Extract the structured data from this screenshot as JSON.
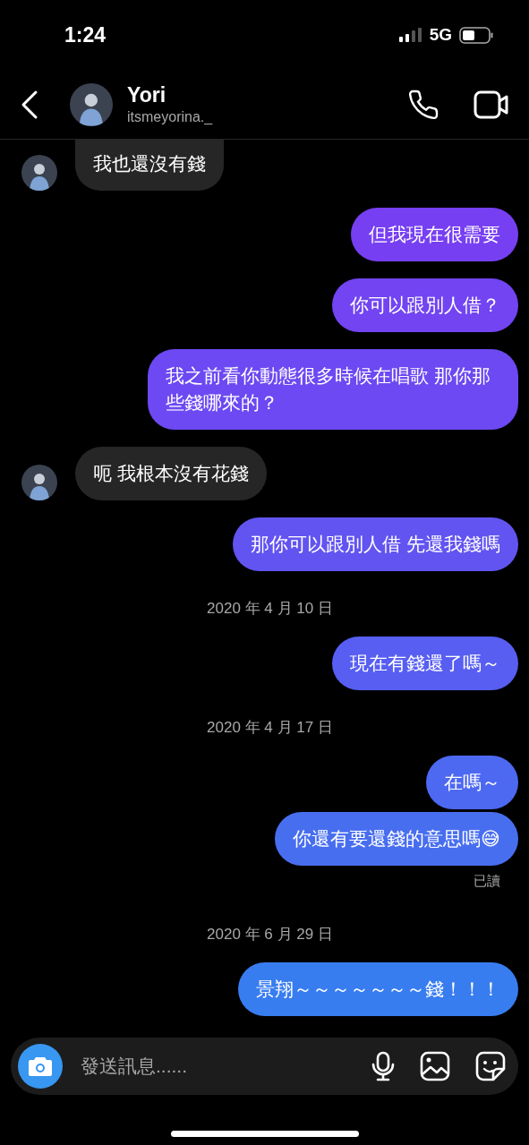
{
  "status_bar": {
    "time": "1:24",
    "network": "5G"
  },
  "header": {
    "name": "Yori",
    "username": "itsmeyorina._"
  },
  "messages": [
    {
      "kind": "received",
      "text": "我也還沒有錢",
      "cut_top": true
    },
    {
      "kind": "sent",
      "text": "但我現在很需要"
    },
    {
      "kind": "sent",
      "text": "你可以跟別人借？"
    },
    {
      "kind": "sent",
      "text": "我之前看你動態很多時候在唱歌 那你那些錢哪來的？"
    },
    {
      "kind": "received",
      "text": "呃 我根本沒有花錢"
    },
    {
      "kind": "sent",
      "text": "那你可以跟別人借 先還我錢嗎"
    },
    {
      "kind": "date",
      "text": "2020 年 4 月 10 日"
    },
    {
      "kind": "sent",
      "text": "現在有錢還了嗎～"
    },
    {
      "kind": "date",
      "text": "2020 年 4 月 17 日"
    },
    {
      "kind": "sent",
      "text": "在嗎～"
    },
    {
      "kind": "sent",
      "text": "你還有要還錢的意思嗎😅"
    },
    {
      "kind": "read",
      "text": "已讀"
    },
    {
      "kind": "date",
      "text": "2020 年 6 月 29 日"
    },
    {
      "kind": "sent",
      "text": "景翔～～～～～～～錢！！！"
    }
  ],
  "composer": {
    "placeholder": "發送訊息......"
  }
}
